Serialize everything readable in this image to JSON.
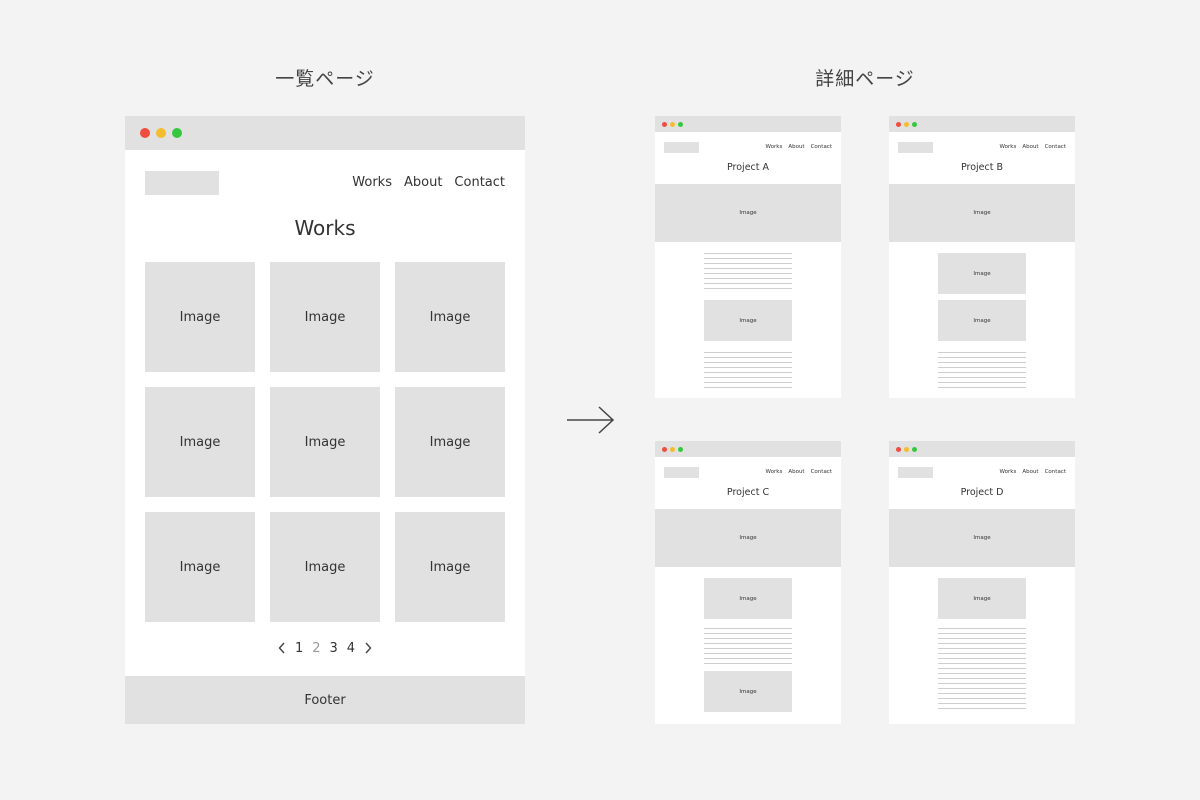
{
  "list_page": {
    "section_title": "一覧ページ",
    "nav": [
      "Works",
      "About",
      "Contact"
    ],
    "heading": "Works",
    "grid_label": "Image",
    "pagination": [
      "1",
      "2",
      "3",
      "4"
    ],
    "footer": "Footer"
  },
  "detail_pages": {
    "section_title": "詳細ページ",
    "nav": [
      "Works",
      "About",
      "Contact"
    ],
    "image_label": "Image",
    "projects": [
      {
        "title": "Project A"
      },
      {
        "title": "Project B"
      },
      {
        "title": "Project C"
      },
      {
        "title": "Project D"
      }
    ]
  },
  "colors": {
    "background": "#f3f3f3",
    "placeholder": "#e1e1e1",
    "close": "#ef4d3f",
    "minimize": "#f3bd2e",
    "zoom": "#35c73f"
  }
}
